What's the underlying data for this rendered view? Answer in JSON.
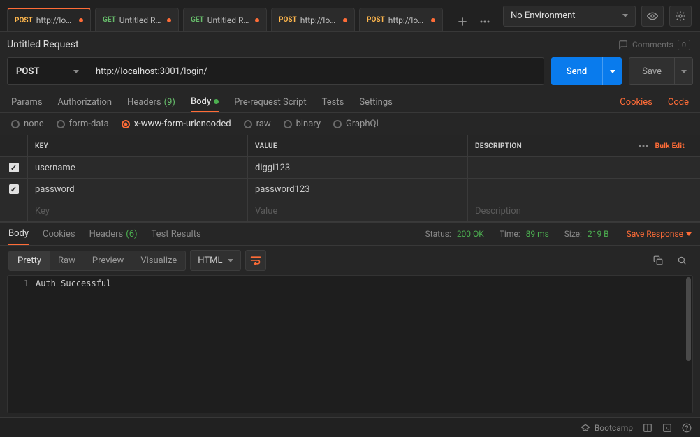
{
  "env": {
    "label": "No Environment"
  },
  "tabs": [
    {
      "method": "POST",
      "methodClass": "m-post",
      "label": "http://loca...",
      "dirty": true,
      "active": true
    },
    {
      "method": "GET",
      "methodClass": "m-get",
      "label": "Untitled Re...",
      "dirty": true,
      "active": false
    },
    {
      "method": "GET",
      "methodClass": "m-get",
      "label": "Untitled Re...",
      "dirty": true,
      "active": false
    },
    {
      "method": "POST",
      "methodClass": "m-post",
      "label": "http://loca...",
      "dirty": true,
      "active": false
    },
    {
      "method": "POST",
      "methodClass": "m-post",
      "label": "http://loca...",
      "dirty": true,
      "active": false
    }
  ],
  "request": {
    "title": "Untitled Request",
    "comments_label": "Comments",
    "comments_count": "0",
    "method": "POST",
    "url": "http://localhost:3001/login/",
    "send": "Send",
    "save": "Save"
  },
  "subtabs": {
    "params": "Params",
    "auth": "Authorization",
    "headers": "Headers",
    "headers_count": "(9)",
    "body": "Body",
    "prereq": "Pre-request Script",
    "tests": "Tests",
    "settings": "Settings",
    "cookies": "Cookies",
    "code": "Code"
  },
  "bodytype": {
    "none": "none",
    "formdata": "form-data",
    "xurl": "x-www-form-urlencoded",
    "raw": "raw",
    "binary": "binary",
    "graphql": "GraphQL"
  },
  "table": {
    "h_key": "KEY",
    "h_val": "VALUE",
    "h_desc": "DESCRIPTION",
    "bulk": "Bulk Edit",
    "rows": [
      {
        "k": "username",
        "v": "diggi123",
        "d": ""
      },
      {
        "k": "password",
        "v": "password123",
        "d": ""
      }
    ],
    "ph_key": "Key",
    "ph_val": "Value",
    "ph_desc": "Description"
  },
  "resp": {
    "tab_body": "Body",
    "tab_cookies": "Cookies",
    "tab_headers": "Headers",
    "tab_headers_count": "(6)",
    "tab_results": "Test Results",
    "status_label": "Status:",
    "status_val": "200 OK",
    "time_label": "Time:",
    "time_val": "89 ms",
    "size_label": "Size:",
    "size_val": "219 B",
    "save_response": "Save Response",
    "view_pretty": "Pretty",
    "view_raw": "Raw",
    "view_preview": "Preview",
    "view_visualize": "Visualize",
    "lang": "HTML",
    "line_no": "1",
    "line_text": "Auth Successful"
  },
  "statusbar": {
    "bootcamp": "Bootcamp"
  }
}
